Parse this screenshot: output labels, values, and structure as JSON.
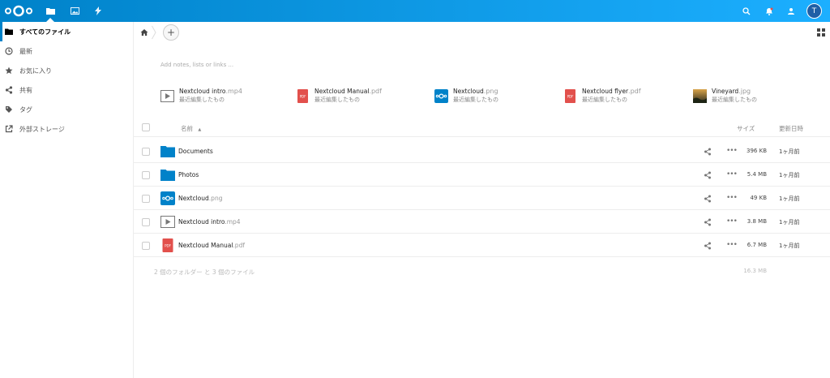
{
  "header": {
    "apps": [
      {
        "icon": "files-folder-icon",
        "active": true
      },
      {
        "icon": "gallery-image-icon",
        "active": false
      },
      {
        "icon": "activity-bolt-icon",
        "active": false
      }
    ],
    "right_icons": [
      "search-icon",
      "notifications-bell-icon",
      "contacts-icon"
    ],
    "avatar_initial": "T",
    "accent_color": "#0082c9"
  },
  "sidebar": {
    "items": [
      {
        "label": "すべてのファイル",
        "icon": "folder-icon",
        "active": true
      },
      {
        "label": "最新",
        "icon": "clock-icon",
        "active": false
      },
      {
        "label": "お気に入り",
        "icon": "star-icon",
        "active": false
      },
      {
        "label": "共有",
        "icon": "share-icon",
        "active": false
      },
      {
        "label": "タグ",
        "icon": "tag-icon",
        "active": false
      },
      {
        "label": "外部ストレージ",
        "icon": "external-link-icon",
        "active": false
      }
    ]
  },
  "breadcrumb": {
    "home_icon": "home-icon",
    "add_label": "+"
  },
  "notes_placeholder": "Add notes, lists or links ...",
  "recent": [
    {
      "name": "Nextcloud intro",
      "ext": ".mp4",
      "sub": "最近編集したもの",
      "icon": "video-icon"
    },
    {
      "name": "Nextcloud Manual",
      "ext": ".pdf",
      "sub": "最近編集したもの",
      "icon": "pdf-icon"
    },
    {
      "name": "Nextcloud",
      "ext": ".png",
      "sub": "最近編集したもの",
      "icon": "nextcloud-image-icon"
    },
    {
      "name": "Nextcloud flyer",
      "ext": ".pdf",
      "sub": "最近編集したもの",
      "icon": "pdf-icon"
    },
    {
      "name": "Vineyard",
      "ext": ".jpg",
      "sub": "最近編集したもの",
      "icon": "photo-thumbnail-icon"
    }
  ],
  "table": {
    "headers": {
      "name": "名前",
      "sort_indicator": "▲",
      "size": "サイズ",
      "modified": "更新日時"
    },
    "rows": [
      {
        "name": "Documents",
        "ext": "",
        "icon": "folder-icon",
        "size": "396 KB",
        "modified": "1ヶ月前"
      },
      {
        "name": "Photos",
        "ext": "",
        "icon": "folder-icon",
        "size": "5.4 MB",
        "modified": "1ヶ月前"
      },
      {
        "name": "Nextcloud",
        "ext": ".png",
        "icon": "nextcloud-image-icon",
        "size": "49 KB",
        "modified": "1ヶ月前"
      },
      {
        "name": "Nextcloud intro",
        "ext": ".mp4",
        "icon": "video-icon",
        "size": "3.8 MB",
        "modified": "1ヶ月前"
      },
      {
        "name": "Nextcloud Manual",
        "ext": ".pdf",
        "icon": "pdf-icon",
        "size": "6.7 MB",
        "modified": "1ヶ月前"
      }
    ],
    "more_label": "•••",
    "summary": {
      "text": "2 個のフォルダー と 3 個のファイル",
      "total_size": "16.3 MB"
    }
  }
}
